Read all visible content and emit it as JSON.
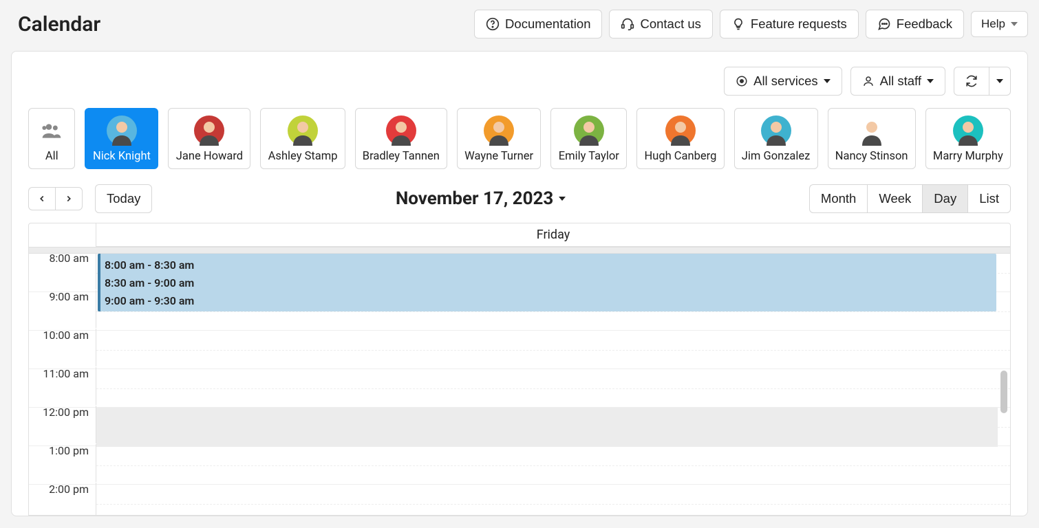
{
  "header": {
    "title": "Calendar",
    "links": {
      "documentation": "Documentation",
      "contact": "Contact us",
      "feature": "Feature requests",
      "feedback": "Feedback",
      "help": "Help"
    }
  },
  "filters": {
    "services": "All services",
    "staff": "All staff"
  },
  "staff": [
    {
      "label": "All",
      "bg": "#ffffff",
      "selected": false,
      "allIcon": true
    },
    {
      "label": "Nick Knight",
      "bg": "#58b6e0",
      "selected": true
    },
    {
      "label": "Jane Howard",
      "bg": "#c53935",
      "selected": false
    },
    {
      "label": "Ashley Stamp",
      "bg": "#c1d23a",
      "selected": false
    },
    {
      "label": "Bradley Tannen",
      "bg": "#e23b3b",
      "selected": false
    },
    {
      "label": "Wayne Turner",
      "bg": "#f29b2b",
      "selected": false
    },
    {
      "label": "Emily Taylor",
      "bg": "#7cb342",
      "selected": false
    },
    {
      "label": "Hugh Canberg",
      "bg": "#ef762e",
      "selected": false
    },
    {
      "label": "Jim Gonzalez",
      "bg": "#3fb2cf",
      "selected": false
    },
    {
      "label": "Nancy Stinson",
      "bg": "#ffffff",
      "selected": false
    },
    {
      "label": "Marry Murphy",
      "bg": "#1cc0bf",
      "selected": false
    }
  ],
  "nav": {
    "today": "Today",
    "date": "November 17, 2023",
    "views": {
      "month": "Month",
      "week": "Week",
      "day": "Day",
      "list": "List",
      "active": "Day"
    },
    "dayName": "Friday"
  },
  "timeSlots": [
    "8:00 am",
    "9:00 am",
    "10:00 am",
    "11:00 am",
    "12:00 pm",
    "1:00 pm",
    "2:00 pm"
  ],
  "events": [
    {
      "text": "8:00 am - 8:30 am"
    },
    {
      "text": "8:30 am - 9:00 am"
    },
    {
      "text": "9:00 am - 9:30 am"
    }
  ],
  "colors": {
    "accent": "#0d8bf2",
    "eventFill": "#b9d7ea",
    "eventBorder": "#3a7ca5"
  }
}
